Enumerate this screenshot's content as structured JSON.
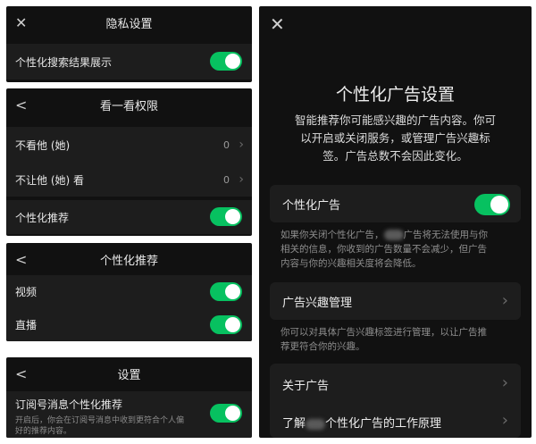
{
  "panel1": {
    "close_icon": "close-icon",
    "title": "隐私设置",
    "row_label": "个性化搜索结果展示",
    "toggle_on": true
  },
  "panel2": {
    "back_icon": "chevron-left-icon",
    "title": "看一看权限",
    "rows": [
      {
        "label": "不看他 (她)",
        "value": "0"
      },
      {
        "label": "不让他 (她) 看",
        "value": "0"
      }
    ],
    "rec_label": "个性化推荐",
    "toggle_on": true
  },
  "panel3": {
    "back_icon": "chevron-left-icon",
    "title": "个性化推荐",
    "rows": [
      {
        "label": "视频",
        "toggle_on": true
      },
      {
        "label": "直播",
        "toggle_on": true
      }
    ]
  },
  "panel4": {
    "back_icon": "chevron-left-icon",
    "title": "设置",
    "row_label": "订阅号消息个性化推荐",
    "row_desc_line1": "开启后，你会在订阅号消息中收到更符合个人偏",
    "row_desc_line2": "好的推荐内容。",
    "toggle_on": true
  },
  "panel5": {
    "close_icon": "close-icon",
    "title": "个性化广告设置",
    "desc_line1": "智能推荐你可能感兴趣的广告内容。你可",
    "desc_line2": "以开启或关闭服务，或管理广告兴趣标",
    "desc_line3": "签。广告总数不会因此变化。",
    "ad_label": "个性化广告",
    "ad_toggle_on": true,
    "ad_note_a": "如果你关闭个性化广告，",
    "ad_note_b": "广告将无法使用与你",
    "ad_note_line2": "相关的信息，你收到的广告数量不会减少，但广告",
    "ad_note_line3": "内容与你的兴趣相关度将会降低。",
    "interest_label": "广告兴趣管理",
    "interest_note_line1": "你可以对具体广告兴趣标签进行管理，以让广告推",
    "interest_note_line2": "荐更符合你的兴趣。",
    "about_label": "关于广告",
    "how_label_a": "了解",
    "how_label_b": "个性化广告的工作原理"
  },
  "colors": {
    "toggle_on": "#07c160",
    "panel_bg": "#111111",
    "row_bg": "#1d1d1d"
  }
}
